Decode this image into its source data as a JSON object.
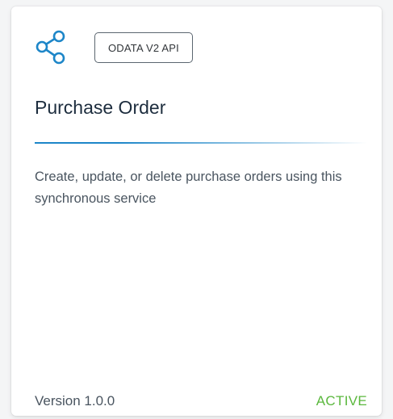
{
  "card": {
    "icon": "share-network-icon",
    "badge": "ODATA V2 API",
    "title": "Purchase Order",
    "description": "Create, update, or delete purchase orders using this synchronous service",
    "version": "Version 1.0.0",
    "status": "ACTIVE"
  },
  "colors": {
    "accent": "#1d86c8",
    "status_active": "#5bb83e",
    "title_text": "#1d2d3e",
    "body_text": "#4a5560"
  }
}
